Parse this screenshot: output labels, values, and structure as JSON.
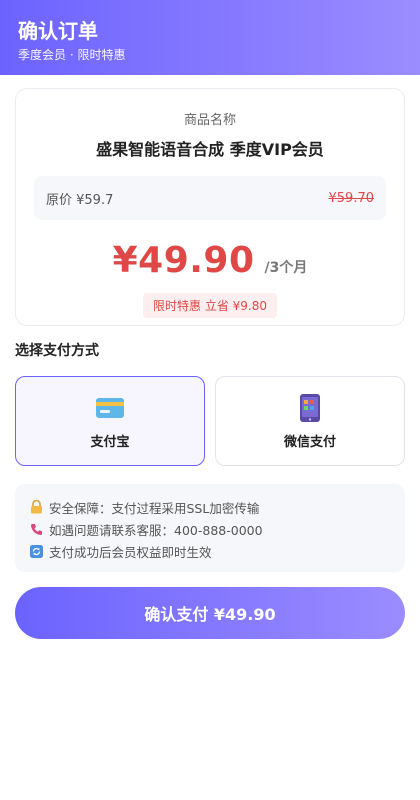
{
  "header": {
    "title": "确认订单",
    "subtitle": "季度会员 · 限时特惠"
  },
  "product": {
    "label": "商品名称",
    "name": "盛果智能语音合成 季度VIP会员",
    "original_price_label": "原价 ¥59.7",
    "original_price_strike": "¥59.70",
    "price": "¥49.90",
    "period": "/3个月",
    "discount": "限时特惠 立省 ¥9.80"
  },
  "payment": {
    "section_title": "选择支付方式",
    "options": [
      {
        "label": "支付宝",
        "icon": "credit-card-icon",
        "selected": true
      },
      {
        "label": "微信支付",
        "icon": "phone-icon",
        "selected": false
      }
    ]
  },
  "notices": [
    {
      "icon": "lock-icon",
      "text": "安全保障：支付过程采用SSL加密传输"
    },
    {
      "icon": "phone-call-icon",
      "text": "如遇问题请联系客服：400-888-0000"
    },
    {
      "icon": "refresh-icon",
      "text": "支付成功后会员权益即时生效"
    }
  ],
  "confirm_button": "确认支付 ¥49.90"
}
